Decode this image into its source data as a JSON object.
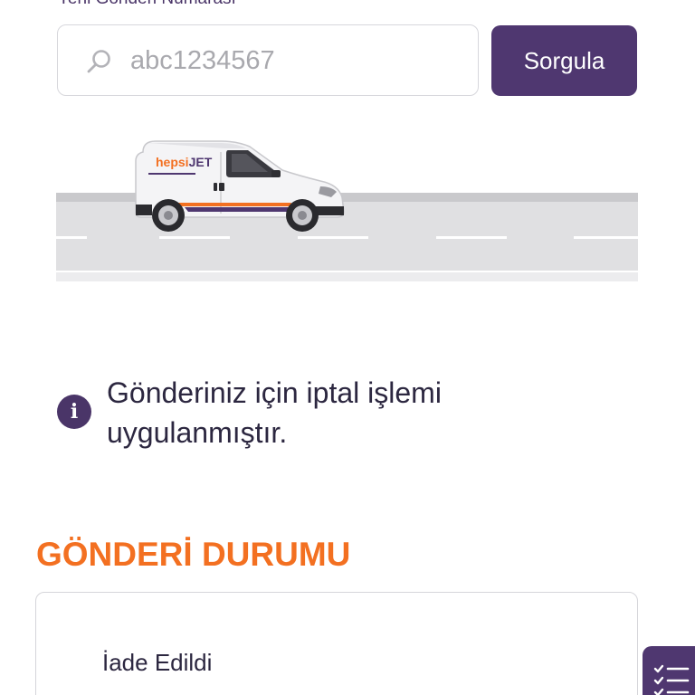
{
  "tracking": {
    "label": "Yeni Gönderi Numarası",
    "placeholder": "abc1234567",
    "query_button": "Sorgula"
  },
  "van": {
    "brand_text_light": "hepsi",
    "brand_text_bold": "JET"
  },
  "notice": {
    "message": "Gönderiniz için iptal işlemi uygulanmıştır."
  },
  "shipment_status": {
    "title": "GÖNDERİ DURUMU",
    "status": "İade Edildi"
  },
  "colors": {
    "brand_purple": "#4f3770",
    "accent_orange": "#f37021"
  },
  "icons": {
    "search": "search-icon",
    "info": "info-icon",
    "fab": "checklist-icon"
  }
}
